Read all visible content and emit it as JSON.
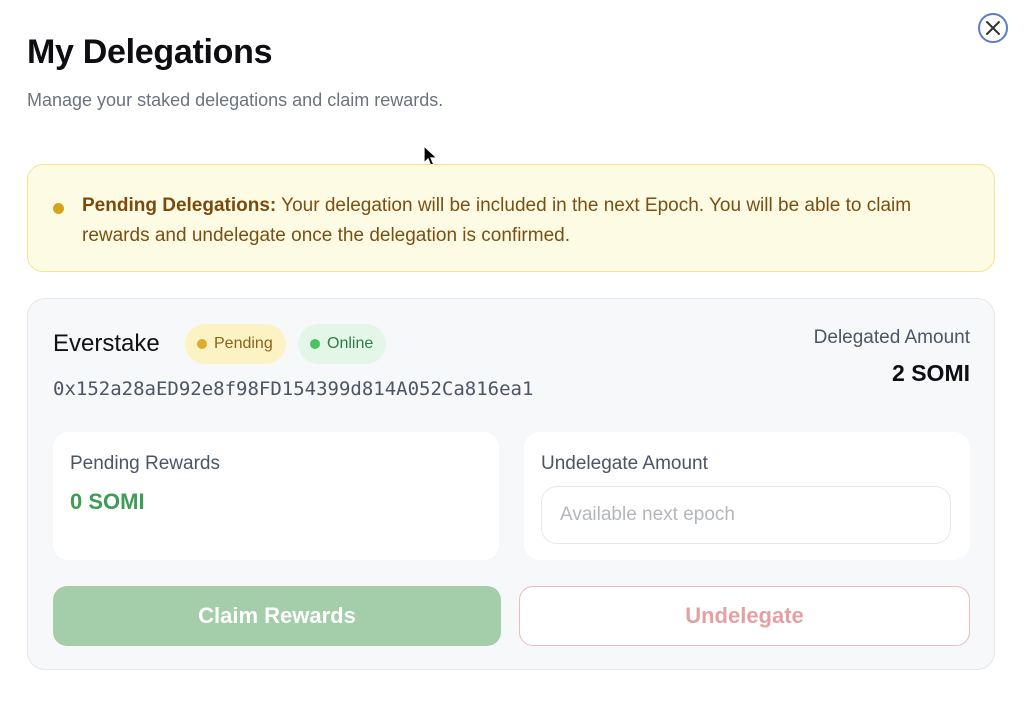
{
  "modal": {
    "title": "My Delegations",
    "subtitle": "Manage your staked delegations and claim rewards.",
    "close_icon": "close-icon"
  },
  "notice": {
    "heading": "Pending Delegations:",
    "message": " Your delegation will be included in the next Epoch. You will be able to claim rewards and undelegate once the delegation is confirmed.",
    "color": "#fefbe5"
  },
  "delegation": {
    "validator_name": "Everstake",
    "badges": {
      "pending": "Pending",
      "online": "Online"
    },
    "address": "0x152a28aED92e8f98FD154399d814A052Ca816ea1",
    "delegated_amount_label": "Delegated Amount",
    "delegated_amount_value": "2 SOMI",
    "pending_rewards_label": "Pending Rewards",
    "pending_rewards_value": "0 SOMI",
    "undelegate_amount_label": "Undelegate Amount",
    "undelegate_amount_placeholder": "Available next epoch",
    "undelegate_amount_value": "",
    "claim_button_label": "Claim Rewards",
    "undelegate_button_label": "Undelegate"
  },
  "colors": {
    "accent_green": "#3e9c57",
    "pending_yellow": "#ddab2f",
    "online_green": "#4cc267",
    "undelegate_red": "#e4a1a3",
    "close_blue": "#5b7cc9"
  }
}
